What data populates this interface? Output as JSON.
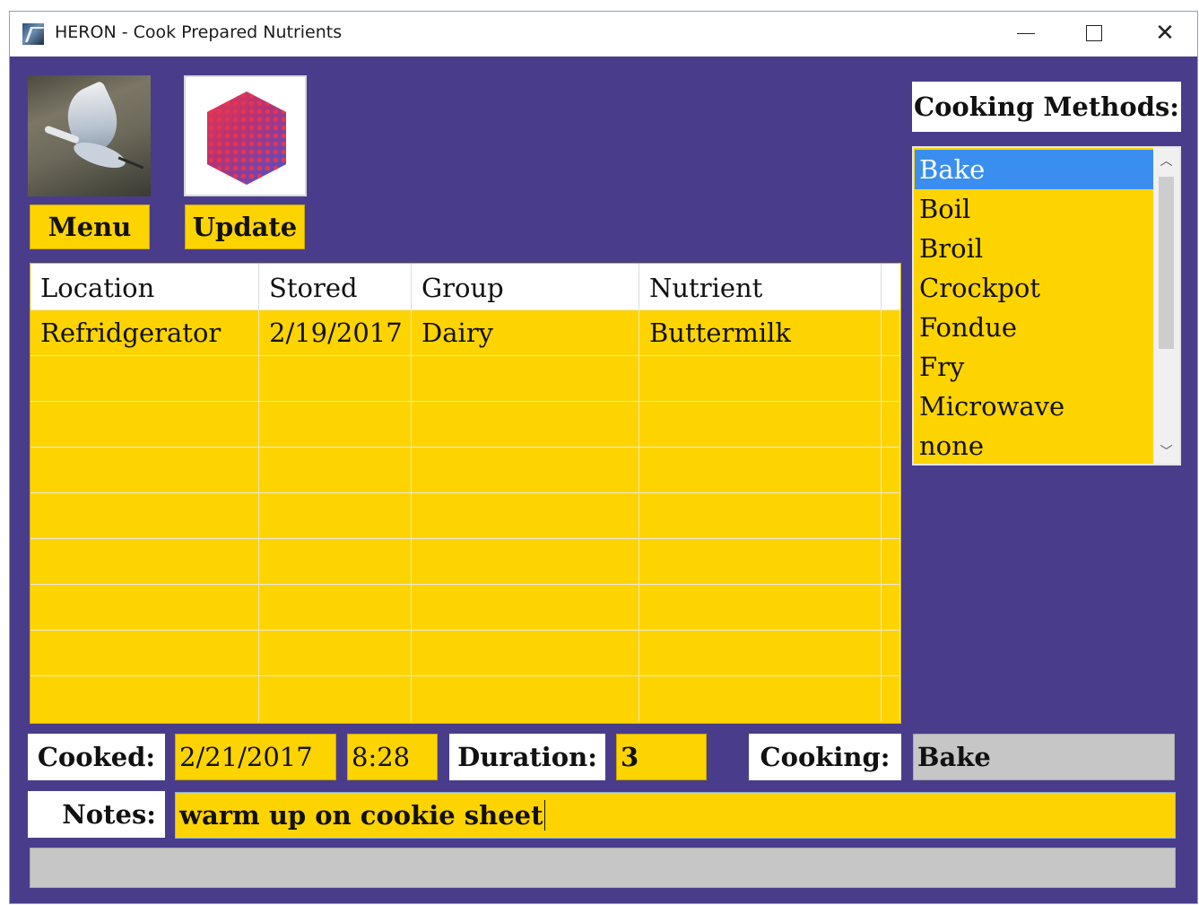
{
  "window": {
    "title": "HERON - Cook Prepared Nutrients",
    "controls": {
      "minimize_icon": "minimize-icon",
      "maximize_icon": "maximize-icon",
      "close_icon": "close-icon"
    }
  },
  "toolbar": {
    "menu_label": "Menu",
    "update_label": "Update"
  },
  "grid": {
    "columns": [
      "Location",
      "Stored",
      "Group",
      "Nutrient"
    ],
    "rows": [
      [
        "Refridgerator",
        "2/19/2017",
        "Dairy",
        "Buttermilk"
      ]
    ]
  },
  "cooking_methods": {
    "label": "Cooking Methods:",
    "items": [
      "Bake",
      "Boil",
      "Broil",
      "Crockpot",
      "Fondue",
      "Fry",
      "Microwave",
      "none"
    ],
    "selected": "Bake"
  },
  "cooked": {
    "label": "Cooked:",
    "date": "2/21/2017",
    "time": "8:28"
  },
  "duration": {
    "label": "Duration:",
    "value": "3"
  },
  "cooking": {
    "label": "Cooking:",
    "value": "Bake"
  },
  "notes": {
    "label": "Notes:",
    "value": "warm up on cookie sheet"
  },
  "colors": {
    "background": "#493d8b",
    "field": "#fed400",
    "selection": "#3a8ef0",
    "readonly": "#c6c6c6"
  }
}
